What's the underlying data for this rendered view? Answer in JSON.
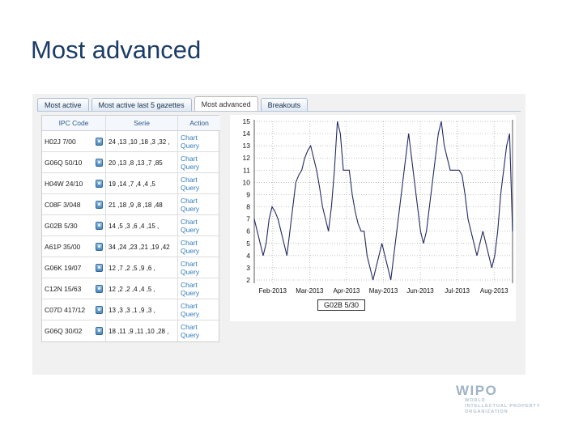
{
  "slide": {
    "title": "Most advanced"
  },
  "tabs": [
    {
      "label": "Most active",
      "active": false
    },
    {
      "label": "Most active last 5 gazettes",
      "active": false
    },
    {
      "label": "Most advanced",
      "active": true
    },
    {
      "label": "Breakouts",
      "active": false
    }
  ],
  "table": {
    "columns": [
      "IPC Code",
      "Serie",
      "Action"
    ],
    "action_labels": {
      "chart": "Chart",
      "query": "Query"
    },
    "lock_icon": "lock-icon",
    "rows": [
      {
        "code": "H02J 7/00",
        "serie": "24 ,13 ,10 ,18 ,3 ,32 ,"
      },
      {
        "code": "G06Q 50/10",
        "serie": "20 ,13 ,8 ,13 ,7 ,85"
      },
      {
        "code": "H04W 24/10",
        "serie": "19 ,14 ,7 ,4 ,4 ,5"
      },
      {
        "code": "C08F 3/048",
        "serie": "21 ,18 ,9 ,8 ,18 ,48"
      },
      {
        "code": "G02B 5/30",
        "serie": "14 ,5 ,3 ,6 ,4 ,15 ,"
      },
      {
        "code": "A61P 35/00",
        "serie": "34 ,24 ,23 ,21 ,19 ,42"
      },
      {
        "code": "G06K 19/07",
        "serie": "12 ,7 ,2 ,5 ,9 ,6 ,"
      },
      {
        "code": "C12N 15/63",
        "serie": "12 ,2 ,2 ,4 ,4 ,5 ,"
      },
      {
        "code": "C07D 417/12",
        "serie": "13 ,3 ,3 ,1 ,9 ,3 ,"
      },
      {
        "code": "G06Q 30/02",
        "serie": "18 ,11 ,9 ,11 ,10 ,28 ,"
      }
    ]
  },
  "chart_data": {
    "type": "line",
    "title": "",
    "xlabel": "",
    "ylabel": "",
    "legend": "G02B 5/30",
    "legend_position": "bottom-center",
    "grid": true,
    "ylim": [
      2,
      15
    ],
    "yticks": [
      2,
      3,
      4,
      5,
      6,
      7,
      8,
      9,
      10,
      11,
      12,
      13,
      14,
      15
    ],
    "xticks": [
      "Feb-2013",
      "Mar-2013",
      "Apr-2013",
      "May-2013",
      "Jun-2013",
      "Jul-2013",
      "Aug-2013"
    ],
    "line_color": "#232a63",
    "series": [
      {
        "name": "G02B 5/30",
        "values": [
          7,
          6,
          5,
          4,
          5,
          7,
          8,
          7.6,
          7,
          6,
          5,
          4,
          6,
          8,
          10,
          10.6,
          11,
          12,
          12.6,
          13,
          12,
          11,
          9.6,
          8,
          7,
          6,
          8,
          11,
          15,
          14,
          11,
          11,
          11,
          9,
          7.6,
          6.6,
          6,
          6,
          4,
          3,
          2,
          3,
          4,
          5,
          4,
          3,
          2,
          4,
          6,
          8,
          10,
          12,
          14,
          12,
          10,
          8,
          6,
          5,
          6,
          8,
          10,
          12,
          14,
          15,
          13,
          12,
          11,
          11,
          11,
          11,
          10.6,
          9,
          7,
          6,
          5,
          4,
          5,
          6,
          5,
          4,
          3,
          4,
          6,
          9,
          11,
          13,
          14,
          6
        ]
      }
    ]
  },
  "wipo": {
    "mark": "WIPO",
    "line1": "WORLD",
    "line2": "INTELLECTUAL PROPERTY",
    "line3": "ORGANIZATION"
  },
  "colors": {
    "title": "#1b3c66",
    "panel_bg": "#f1f1f1",
    "tab_active": "#ffffff",
    "link": "#2f7bc0",
    "chart_line": "#232a63",
    "header_text": "#2e5a8e"
  }
}
